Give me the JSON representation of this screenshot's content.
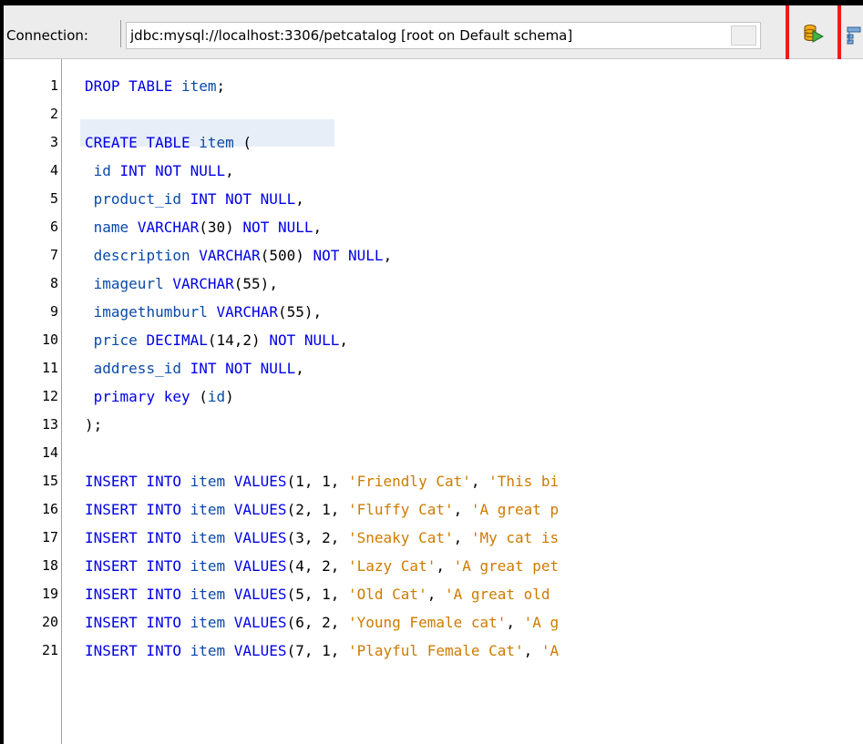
{
  "toolbar": {
    "connection_label": "Connection:",
    "connection_value": "jdbc:mysql://localhost:3306/petcatalog [root on Default schema]",
    "run_icon": "run-sql-icon",
    "next_icon": "execution-plan-icon",
    "highlight_color": "#ee1c1c"
  },
  "editor": {
    "lines": [
      {
        "num": "1",
        "text": "DROP TABLE item;"
      },
      {
        "num": "2",
        "text": ""
      },
      {
        "num": "3",
        "text": "CREATE TABLE item ("
      },
      {
        "num": "4",
        "text": " id INT NOT NULL,"
      },
      {
        "num": "5",
        "text": " product_id INT NOT NULL,"
      },
      {
        "num": "6",
        "text": " name VARCHAR(30) NOT NULL,"
      },
      {
        "num": "7",
        "text": " description VARCHAR(500) NOT NULL,"
      },
      {
        "num": "8",
        "text": " imageurl VARCHAR(55),"
      },
      {
        "num": "9",
        "text": " imagethumburl VARCHAR(55),"
      },
      {
        "num": "10",
        "text": " price DECIMAL(14,2) NOT NULL,"
      },
      {
        "num": "11",
        "text": " address_id INT NOT NULL,"
      },
      {
        "num": "12",
        "text": " primary key (id)"
      },
      {
        "num": "13",
        "text": ");"
      },
      {
        "num": "14",
        "text": ""
      },
      {
        "num": "15",
        "text": "INSERT INTO item VALUES(1, 1, 'Friendly Cat', 'This bi"
      },
      {
        "num": "16",
        "text": "INSERT INTO item VALUES(2, 1, 'Fluffy Cat', 'A great p"
      },
      {
        "num": "17",
        "text": "INSERT INTO item VALUES(3, 2, 'Sneaky Cat', 'My cat is"
      },
      {
        "num": "18",
        "text": "INSERT INTO item VALUES(4, 2, 'Lazy Cat', 'A great pet"
      },
      {
        "num": "19",
        "text": "INSERT INTO item VALUES(5, 1, 'Old Cat', 'A great old"
      },
      {
        "num": "20",
        "text": "INSERT INTO item VALUES(6, 2, 'Young Female cat', 'A g"
      },
      {
        "num": "21",
        "text": "INSERT INTO item VALUES(7, 1, 'Playful Female Cat', 'A"
      }
    ]
  }
}
